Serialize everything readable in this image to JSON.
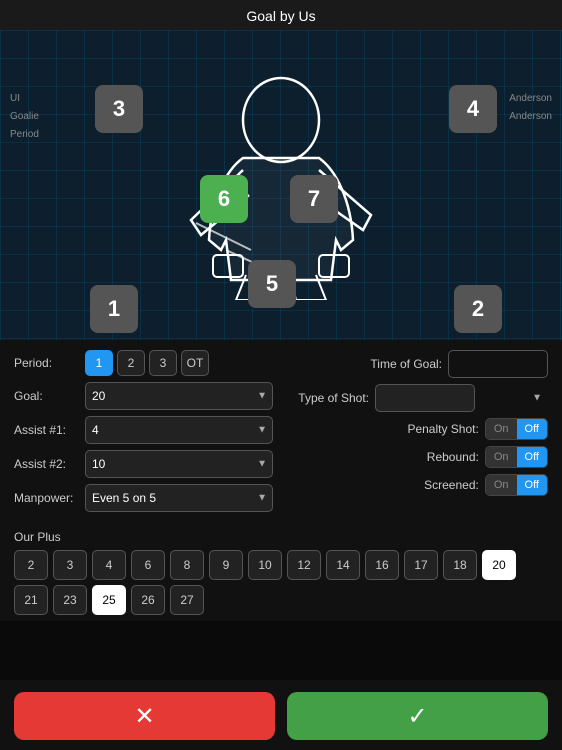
{
  "title": "Goal by Us",
  "rink": {
    "zones": [
      {
        "id": "3",
        "label": "3",
        "active": false
      },
      {
        "id": "4",
        "label": "4",
        "active": false
      },
      {
        "id": "6",
        "label": "6",
        "active": true
      },
      {
        "id": "7",
        "label": "7",
        "active": false
      },
      {
        "id": "5",
        "label": "5",
        "active": false
      },
      {
        "id": "1",
        "label": "1",
        "active": false
      },
      {
        "id": "2",
        "label": "2",
        "active": false
      }
    ],
    "rink_labels": {
      "left_labels": [
        "UI",
        "Goalie",
        "Period"
      ],
      "right_labels": [
        "Anderson",
        "Anderson",
        ""
      ]
    }
  },
  "controls": {
    "period": {
      "label": "Period:",
      "options": [
        "1",
        "2",
        "3",
        "OT"
      ],
      "selected": "1"
    },
    "time_of_goal": {
      "label": "Time of Goal:",
      "value": ""
    },
    "goal": {
      "label": "Goal:",
      "value": "20",
      "options": [
        "20"
      ]
    },
    "type_of_shot": {
      "label": "Type of Shot:",
      "value": "",
      "options": []
    },
    "assist1": {
      "label": "Assist #1:",
      "value": "4",
      "options": [
        "4"
      ]
    },
    "penalty_shot": {
      "label": "Penalty Shot:",
      "on_label": "On",
      "off_label": "Off",
      "selected": "Off"
    },
    "assist2": {
      "label": "Assist #2:",
      "value": "10",
      "options": [
        "10"
      ]
    },
    "rebound": {
      "label": "Rebound:",
      "on_label": "On",
      "off_label": "Off",
      "selected": "Off"
    },
    "manpower": {
      "label": "Manpower:",
      "value": "Even 5 on 5",
      "options": [
        "Even 5 on 5"
      ]
    },
    "screened": {
      "label": "Screened:",
      "on_label": "On",
      "off_label": "Off",
      "selected": "Off"
    }
  },
  "our_plus": {
    "label": "Our Plus",
    "numbers": [
      2,
      3,
      4,
      6,
      8,
      9,
      10,
      12,
      14,
      16,
      17,
      18,
      20,
      21,
      23,
      25,
      26,
      27
    ],
    "selected": [
      20,
      25
    ]
  },
  "buttons": {
    "cancel_label": "✕",
    "confirm_label": "✓"
  }
}
